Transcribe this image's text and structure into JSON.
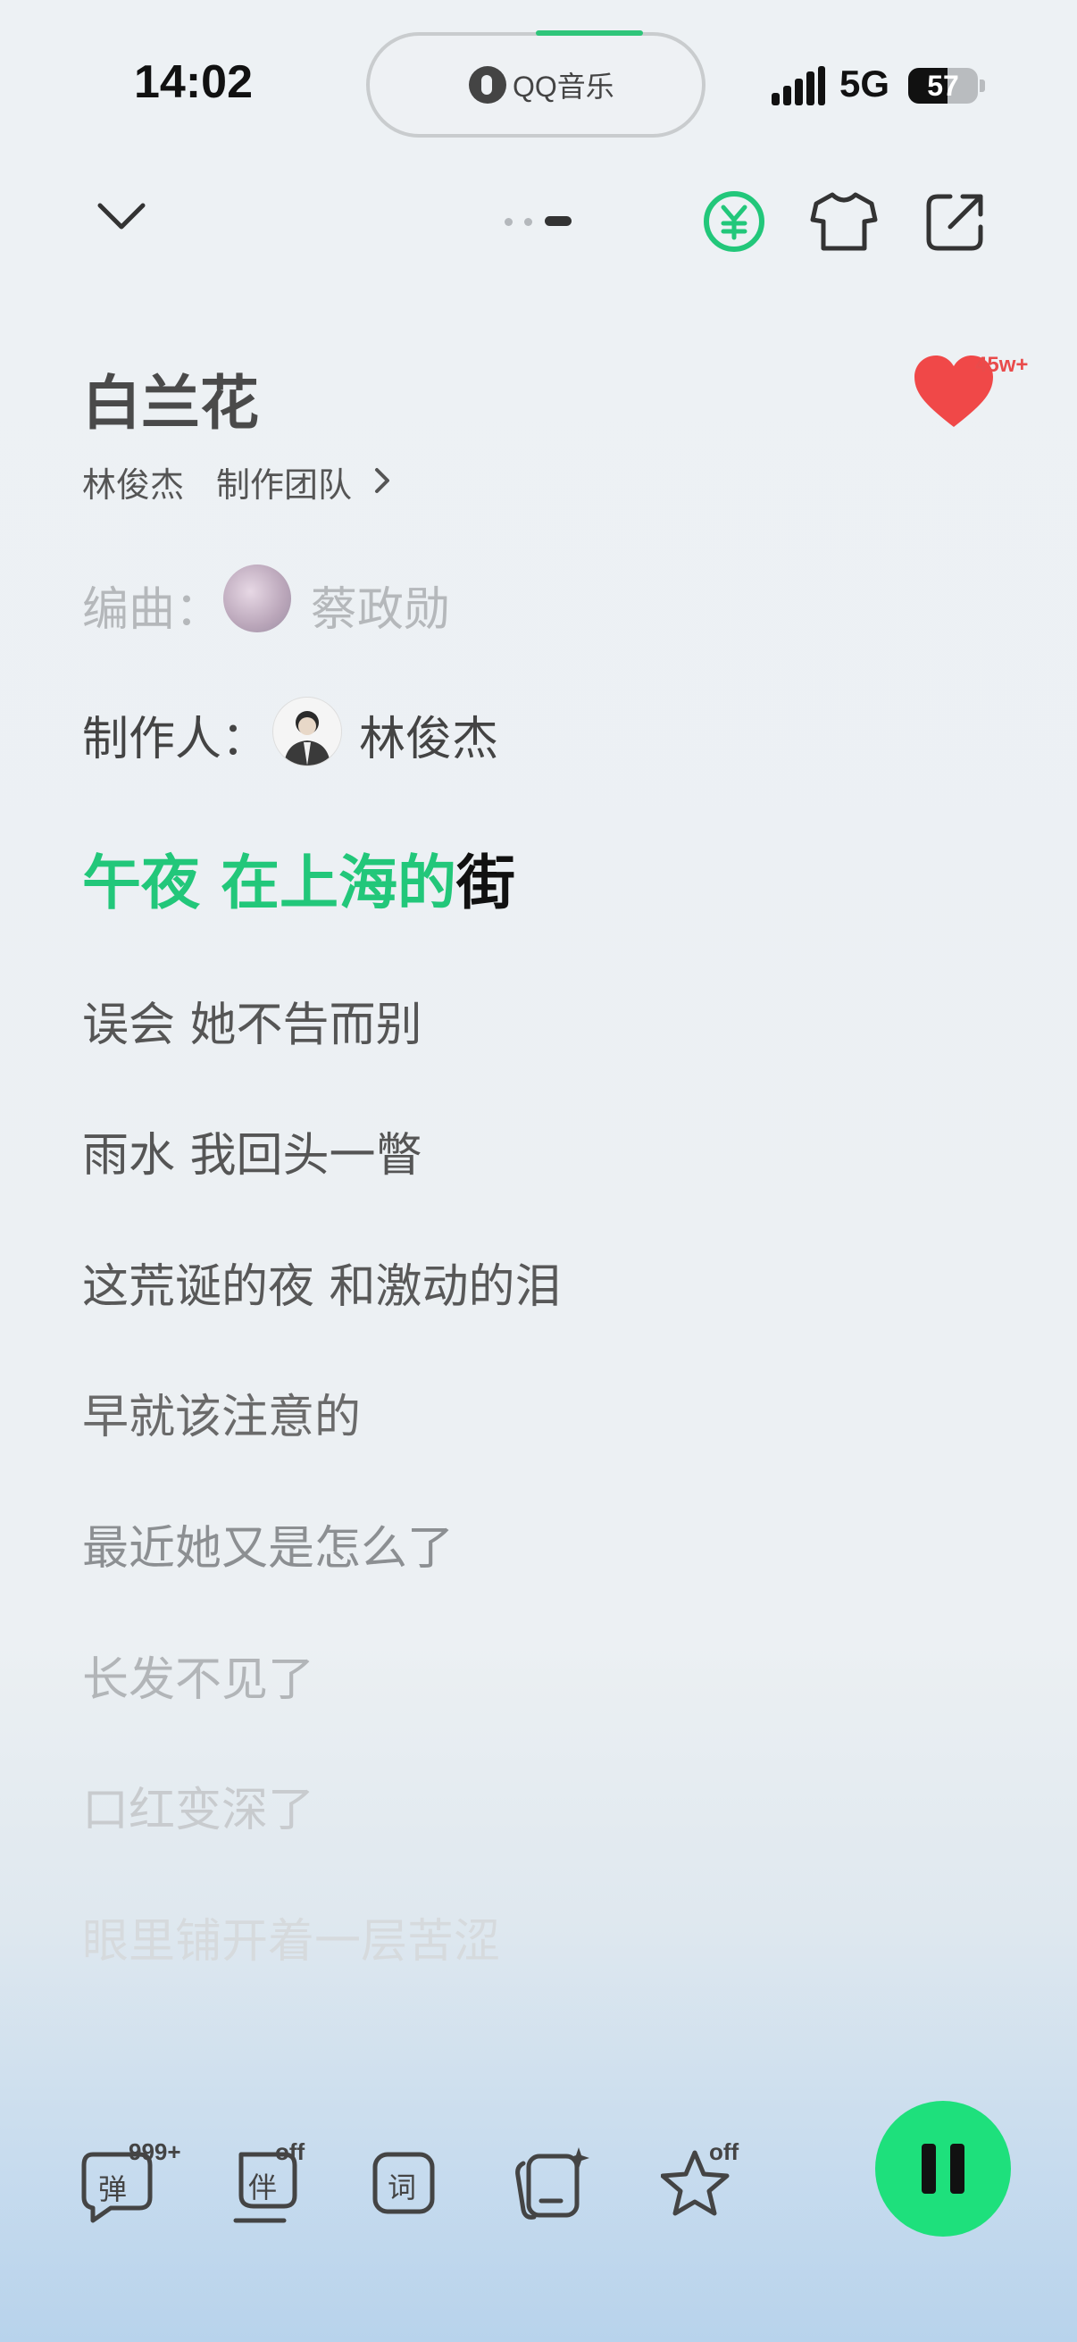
{
  "status_bar": {
    "time": "14:02",
    "island_app": "QQ音乐",
    "network": "5G",
    "battery": "57"
  },
  "song": {
    "title": "白兰花",
    "artist": "林俊杰",
    "team_link": "制作团队",
    "likes": "45w+"
  },
  "credits": [
    {
      "label": "编曲：",
      "name": "蔡政勋"
    },
    {
      "label": "制作人：",
      "name": "林俊杰"
    }
  ],
  "current_lyric": {
    "sung": "午夜 在上海的",
    "unsung": "街"
  },
  "lyrics": [
    "误会 她不告而别",
    "雨水 我回头一瞥",
    "这荒诞的夜 和激动的泪",
    "早就该注意的",
    "最近她又是怎么了",
    "长发不见了",
    "口红变深了",
    "眼里铺开着一层苦涩"
  ],
  "toolbar": {
    "danmaku_label": "弹",
    "danmaku_badge": "999+",
    "accompany_label": "伴",
    "accompany_badge": "off",
    "lyrics_label": "词",
    "favorite_badge": "off"
  },
  "colors": {
    "accent": "#22c77a",
    "play_button": "#1ee07c",
    "like": "#f04848"
  }
}
